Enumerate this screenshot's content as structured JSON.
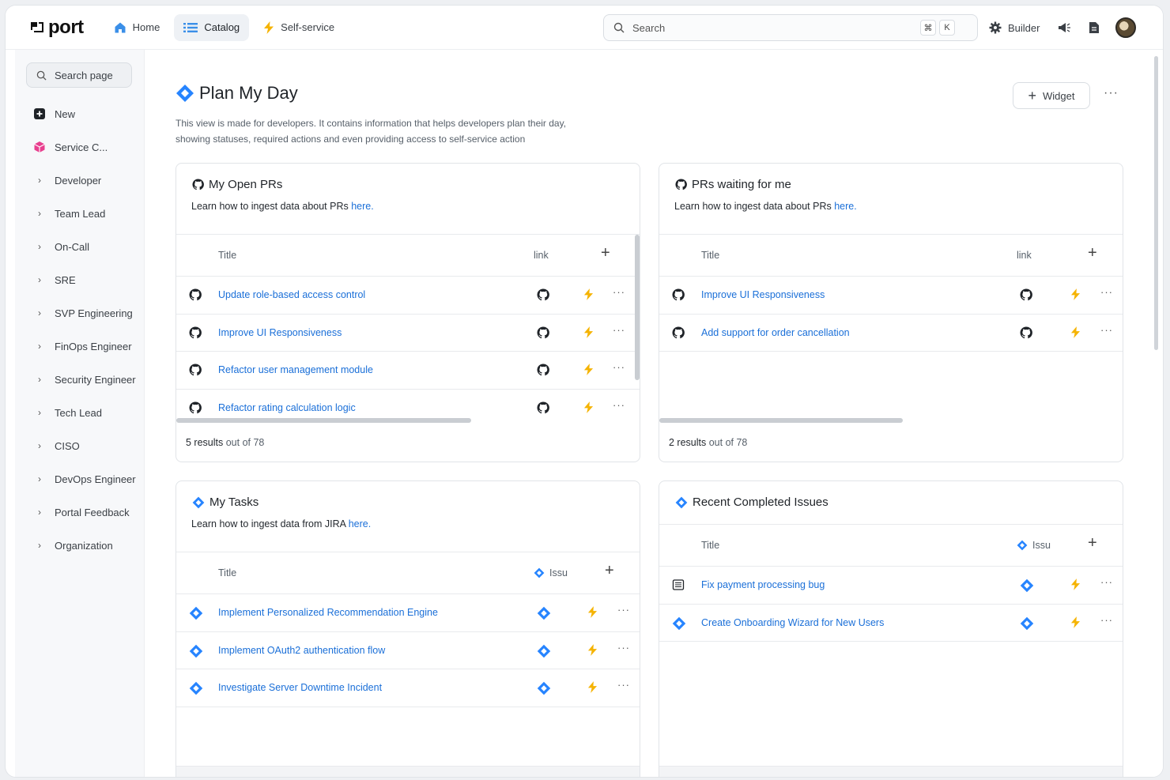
{
  "nav": {
    "logo_text": "port",
    "items": [
      {
        "label": "Home",
        "icon": "home-icon"
      },
      {
        "label": "Catalog",
        "icon": "list-icon",
        "active": true
      },
      {
        "label": "Self-service",
        "icon": "bolt-icon"
      }
    ],
    "search_placeholder": "Search",
    "shortcut_keys": [
      "⌘",
      "K"
    ],
    "builder_label": "Builder"
  },
  "sidebar": {
    "search_label": "Search page",
    "items": [
      {
        "label": "New",
        "icon": "plus-square-icon"
      },
      {
        "label": "Service C...",
        "icon": "cube-icon"
      },
      {
        "label": "Developer",
        "icon": "chevron-right-icon"
      },
      {
        "label": "Team Lead",
        "icon": "chevron-right-icon"
      },
      {
        "label": "On-Call",
        "icon": "chevron-right-icon"
      },
      {
        "label": "SRE",
        "icon": "chevron-right-icon"
      },
      {
        "label": "SVP Engineering",
        "icon": "chevron-right-icon"
      },
      {
        "label": "FinOps Engineer",
        "icon": "chevron-right-icon"
      },
      {
        "label": "Security Engineer",
        "icon": "chevron-right-icon"
      },
      {
        "label": "Tech Lead",
        "icon": "chevron-right-icon"
      },
      {
        "label": "CISO",
        "icon": "chevron-right-icon"
      },
      {
        "label": "DevOps Engineer",
        "icon": "chevron-right-icon"
      },
      {
        "label": "Portal Feedback",
        "icon": "chevron-right-icon"
      },
      {
        "label": "Organization",
        "icon": "chevron-right-icon"
      }
    ]
  },
  "page": {
    "title": "Plan My Day",
    "description_line1": "This view is made for developers. It contains information that helps developers plan their day,",
    "description_line2": "showing statuses, required actions and even providing access to self-service action",
    "widget_button": "Widget"
  },
  "widgets": {
    "my_open_prs": {
      "title": "My Open PRs",
      "subtitle": "Learn how to ingest data about PRs ",
      "link_text": "here.",
      "col_title": "Title",
      "col_extra": "link",
      "rows": [
        "Update role-based access control",
        "Improve UI Responsiveness",
        "Refactor user management module",
        "Refactor rating calculation logic"
      ],
      "footer_count": "5 results",
      "footer_total": " out of 78"
    },
    "prs_waiting": {
      "title": "PRs waiting for me",
      "subtitle": "Learn how to ingest data about PRs ",
      "link_text": "here.",
      "col_title": "Title",
      "col_extra": "link",
      "rows": [
        "Improve UI Responsiveness",
        "Add support for order cancellation"
      ],
      "footer_count": "2 results",
      "footer_total": " out of 78"
    },
    "my_tasks": {
      "title": "My Tasks",
      "subtitle": "Learn how to ingest data from JIRA ",
      "link_text": "here.",
      "col_title": "Title",
      "col_extra": "Issu",
      "rows": [
        "Implement Personalized Recommendation Engine",
        "Implement OAuth2 authentication flow",
        "Investigate Server Downtime Incident"
      ]
    },
    "recent_issues": {
      "title": "Recent Completed Issues",
      "col_title": "Title",
      "col_extra": "Issu",
      "rows": [
        "Fix payment processing bug",
        "Create Onboarding Wizard for New Users"
      ]
    }
  },
  "colors": {
    "link": "#1a6fd8",
    "jira": "#2684ff",
    "bolt": "#f5b301",
    "home": "#3b8fe8",
    "cube": "#e8408f"
  }
}
